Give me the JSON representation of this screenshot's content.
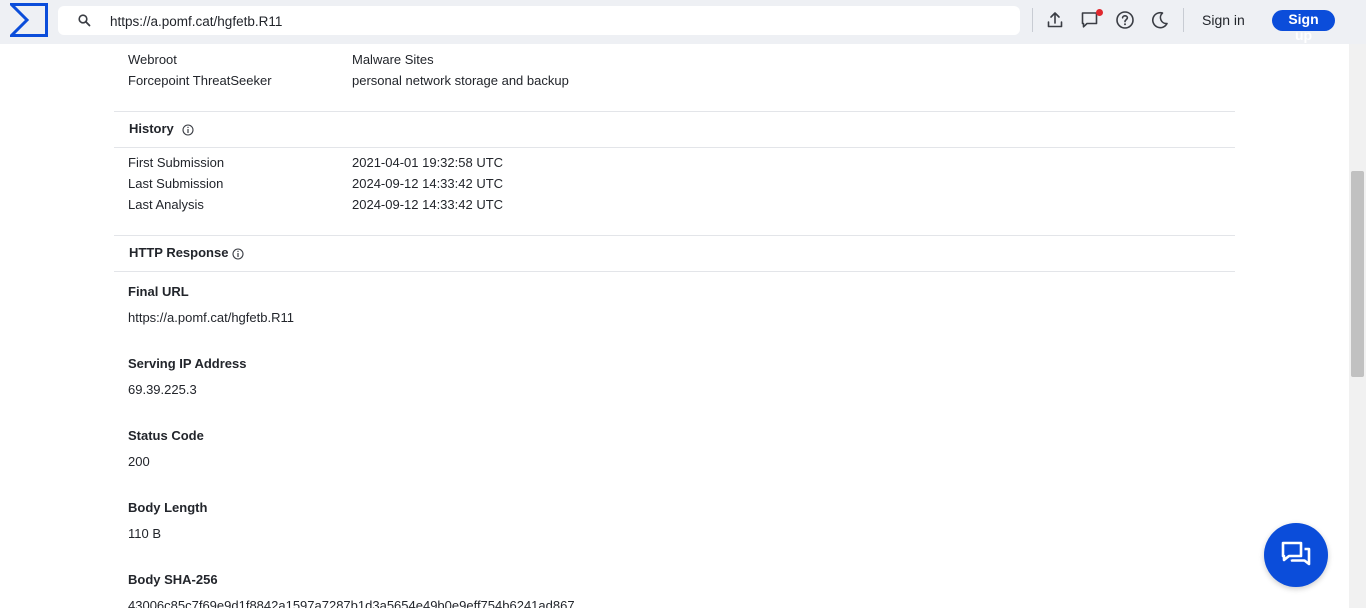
{
  "header": {
    "search_value": "https://a.pomf.cat/hgfetb.R11",
    "signin_label": "Sign in",
    "signup_label": "Sign up",
    "notification_badge_color": "#e0282e",
    "accent_color": "#0b4dda",
    "icons": [
      "upload-icon",
      "notifications-icon",
      "help-icon",
      "dark-mode-icon"
    ]
  },
  "categories": {
    "rows": [
      {
        "vendor": "Webroot",
        "category": "Malware Sites"
      },
      {
        "vendor": "Forcepoint ThreatSeeker",
        "category": "personal network storage and backup"
      }
    ]
  },
  "history": {
    "title": "History",
    "rows": [
      {
        "label": "First Submission",
        "value": "2021-04-01 19:32:58 UTC"
      },
      {
        "label": "Last Submission",
        "value": "2024-09-12 14:33:42 UTC"
      },
      {
        "label": "Last Analysis",
        "value": "2024-09-12 14:33:42 UTC"
      }
    ]
  },
  "http_response": {
    "title": "HTTP Response",
    "fields": [
      {
        "label": "Final URL",
        "value": "https://a.pomf.cat/hgfetb.R11"
      },
      {
        "label": "Serving IP Address",
        "value": "69.39.225.3"
      },
      {
        "label": "Status Code",
        "value": "200"
      },
      {
        "label": "Body Length",
        "value": "110 B"
      },
      {
        "label": "Body SHA-256",
        "value": "43006c85c7f69e9d1f8842a1597a7287b1d3a5654e49b0e9eff754b6241ad867"
      }
    ]
  }
}
